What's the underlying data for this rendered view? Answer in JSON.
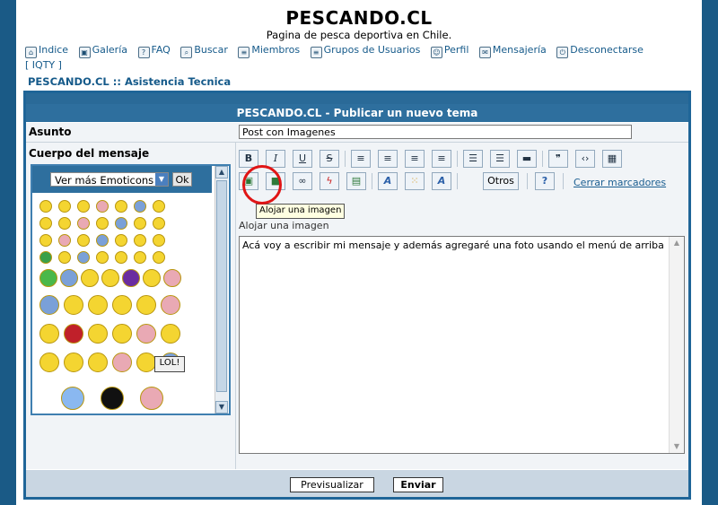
{
  "site": {
    "title": "PESCANDO.CL",
    "subtitle": "Pagina de pesca deportiva en Chile."
  },
  "nav": [
    {
      "label": "Indice",
      "icon": "home-icon"
    },
    {
      "label": "Galería",
      "icon": "gallery-icon"
    },
    {
      "label": "FAQ",
      "icon": "faq-icon"
    },
    {
      "label": "Buscar",
      "icon": "search-icon"
    },
    {
      "label": "Miembros",
      "icon": "members-icon"
    },
    {
      "label": "Grupos de Usuarios",
      "icon": "groups-icon"
    },
    {
      "label": "Perfil",
      "icon": "profile-icon"
    },
    {
      "label": "Mensajería",
      "icon": "messages-icon"
    },
    {
      "label": "Desconectarse",
      "icon": "logout-icon"
    }
  ],
  "nav_extra": "[ IQTY ]",
  "breadcrumb": "PESCANDO.CL :: Asistencia Tecnica",
  "form": {
    "title": "PESCANDO.CL - Publicar un nuevo tema",
    "subject_label": "Asunto",
    "subject_value": "Post con Imagenes",
    "body_label": "Cuerpo del mensaje",
    "emoticons_select": "Ver más Emoticons",
    "emoticons_ok": "Ok",
    "toolbar": {
      "bold": "B",
      "italic": "I",
      "underline": "U",
      "strike": "S",
      "otros": "Otros",
      "cerrar": "Cerrar marcadores"
    },
    "tooltip": "Alojar una imagen",
    "help_line": "Alojar una imagen",
    "message": "Acá voy a escribir mi mensaje y además agregaré una foto usando el menú de arriba",
    "preview_button": "Previsualizar",
    "send_button": "Enviar",
    "lol_sign": "LOL!"
  },
  "colors": {
    "brand_blue": "#1f6598",
    "highlight_red": "#e01515"
  }
}
